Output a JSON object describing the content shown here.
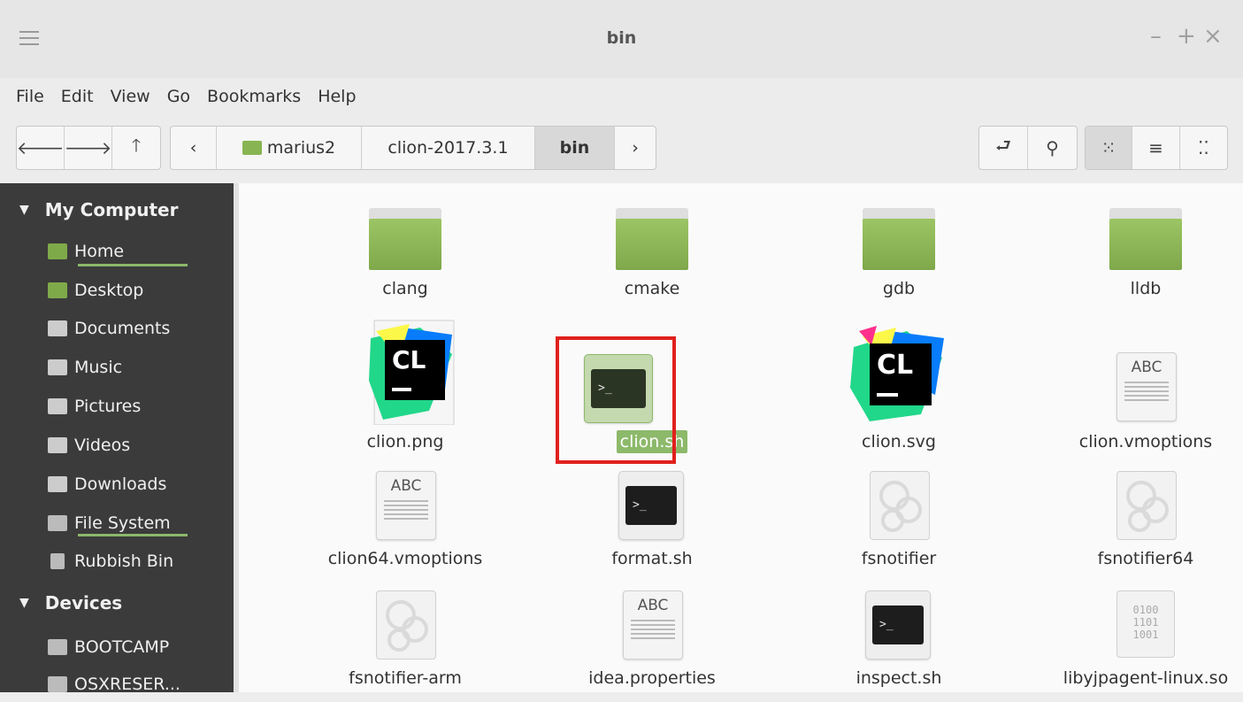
{
  "window": {
    "title": "bin",
    "controls": [
      "–",
      "+",
      "×"
    ]
  },
  "menubar": [
    "File",
    "Edit",
    "View",
    "Go",
    "Bookmarks",
    "Help"
  ],
  "toolbar": {
    "back": "🡐",
    "forward": "🡒",
    "up": "🡑",
    "crumb_prev": "‹",
    "crumb_next": "›",
    "breadcrumbs": [
      "marius2",
      "clion-2017.3.1",
      "bin"
    ],
    "toggle_location": "⮐",
    "search": "⚲",
    "view_icons": "⁙",
    "view_list": "≡",
    "view_compact": "⁚⁚"
  },
  "sidebar": {
    "sections": [
      {
        "title": "My Computer",
        "items": [
          "Home",
          "Desktop",
          "Documents",
          "Music",
          "Pictures",
          "Videos",
          "Downloads",
          "File System",
          "Rubbish Bin"
        ]
      },
      {
        "title": "Devices",
        "items": [
          "BOOTCAMP",
          "OSXRESER..."
        ]
      }
    ]
  },
  "files": [
    {
      "name": "clang",
      "icon": "folder-icon"
    },
    {
      "name": "cmake",
      "icon": "folder-icon"
    },
    {
      "name": "gdb",
      "icon": "folder-icon"
    },
    {
      "name": "lldb",
      "icon": "folder-icon"
    },
    {
      "name": "clion.png",
      "icon": "clion-image-icon"
    },
    {
      "name": "clion.sh",
      "icon": "terminal-script-icon",
      "selected": true
    },
    {
      "name": "clion.svg",
      "icon": "clion-logo-icon"
    },
    {
      "name": "clion.vmoptions",
      "icon": "text-document-icon"
    },
    {
      "name": "clion64.vmoptions",
      "icon": "text-document-icon"
    },
    {
      "name": "format.sh",
      "icon": "terminal-script-icon"
    },
    {
      "name": "fsnotifier",
      "icon": "executable-gear-icon"
    },
    {
      "name": "fsnotifier64",
      "icon": "executable-gear-icon"
    },
    {
      "name": "fsnotifier-arm",
      "icon": "executable-gear-icon"
    },
    {
      "name": "idea.properties",
      "icon": "text-document-icon"
    },
    {
      "name": "inspect.sh",
      "icon": "terminal-script-icon"
    },
    {
      "name": "libyjpagent-linux.so",
      "icon": "binary-library-icon"
    }
  ],
  "icon_text": {
    "cl": "CL",
    "abc": "ABC",
    "prompt": ">_",
    "binary": [
      "0100",
      "1101",
      "1001"
    ]
  },
  "colors": {
    "accent_green": "#8db96b",
    "sidebar_bg": "#3b3b3b",
    "highlight_red": "#e0201c"
  }
}
